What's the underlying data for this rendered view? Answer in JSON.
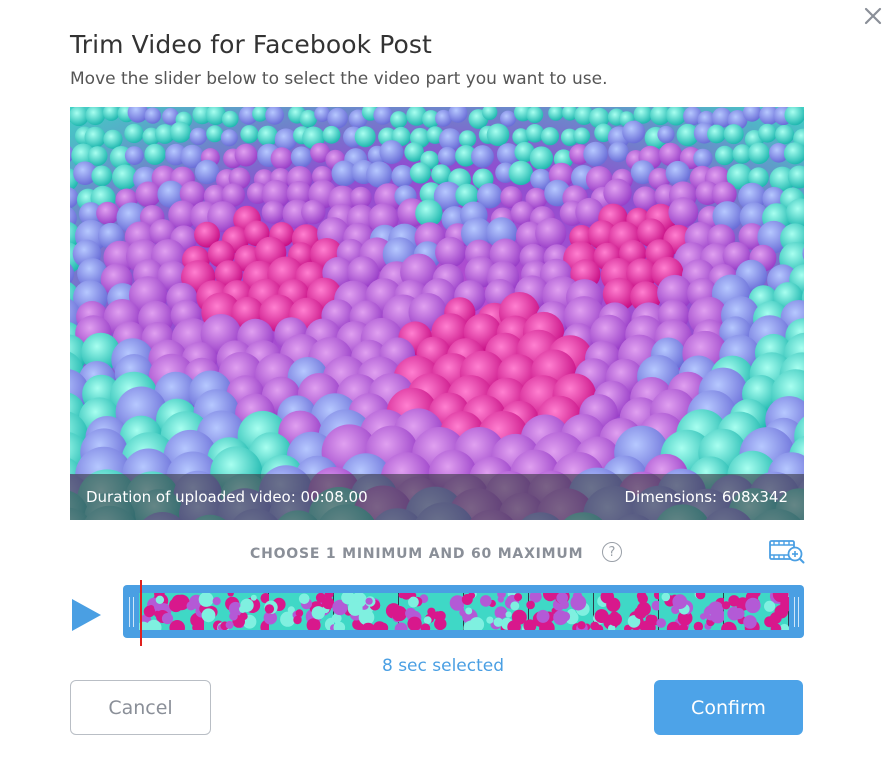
{
  "dialog": {
    "title": "Trim Video for Facebook Post",
    "subtitle": "Move the slider below to select the video part you want to use."
  },
  "video": {
    "duration_label": "Duration of uploaded video: 00:08.00",
    "dimensions_label": "Dimensions: 608x342"
  },
  "trim": {
    "constraint_label": "CHOOSE 1 MINIMUM AND 60 MAXIMUM",
    "help_glyph": "?",
    "selected_label": "8 sec selected",
    "frame_count": 10
  },
  "actions": {
    "cancel_label": "Cancel",
    "confirm_label": "Confirm"
  },
  "colors": {
    "accent": "#4a9fe3",
    "playhead": "#e0201e",
    "magenta": "#d8188c",
    "violet": "#b35ad6",
    "teal": "#3fe0c8"
  }
}
